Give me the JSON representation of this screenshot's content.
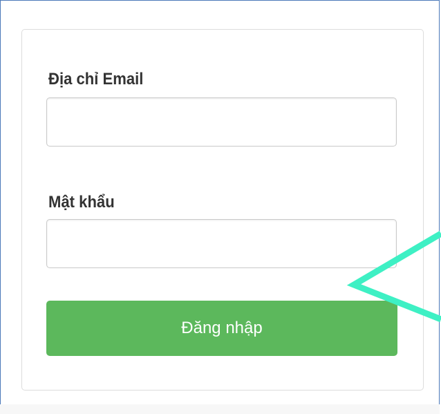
{
  "form": {
    "email_label": "Địa chỉ Email",
    "email_value": "",
    "password_label": "Mật khẩu",
    "password_value": "",
    "submit_label": "Đăng nhập"
  },
  "colors": {
    "button": "#5cb85c",
    "annotation_arrow": "#3ef0c4",
    "frame_border": "#4a78b8"
  },
  "annotation": {
    "icon": "arrow-pointer-icon"
  }
}
